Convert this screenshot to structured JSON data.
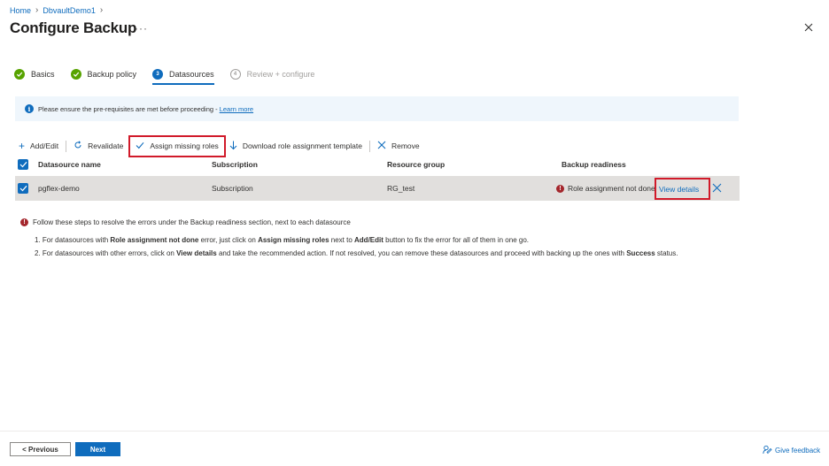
{
  "breadcrumb": {
    "items": [
      "Home",
      "DbvaultDemo1"
    ]
  },
  "page": {
    "title": "Configure Backup",
    "more": "···"
  },
  "steps": [
    {
      "label": "Basics",
      "state": "done"
    },
    {
      "label": "Backup policy",
      "state": "done"
    },
    {
      "label": "Datasources",
      "state": "current",
      "number": "3"
    },
    {
      "label": "Review + configure",
      "state": "future",
      "number": "4"
    }
  ],
  "info": {
    "text": "Please ensure the pre-requisites are met before proceeding - ",
    "link": "Learn more"
  },
  "toolbar": {
    "add_edit": "Add/Edit",
    "revalidate": "Revalidate",
    "assign_roles": "Assign missing roles",
    "download_template": "Download role assignment template",
    "remove": "Remove"
  },
  "table": {
    "headers": [
      "Datasource name",
      "Subscription",
      "Resource group",
      "Backup readiness"
    ],
    "rows": [
      {
        "name": "pgflex-demo",
        "subscription": "Subscription",
        "resource_group": "RG_test",
        "readiness": "Role assignment not done",
        "action": "View details"
      }
    ]
  },
  "instructions": {
    "note": "Follow these steps to resolve the errors under the Backup readiness section, next to each datasource",
    "step1": {
      "p1": "1. For datasources with ",
      "b1": "Role assignment not done",
      "p2": " error, just click on ",
      "b2": "Assign missing roles",
      "p3": " next to ",
      "b3": "Add/Edit",
      "p4": " button to fix the error for all of them in one go."
    },
    "step2": {
      "p1": "2. For datasources with other errors, click on ",
      "b1": "View details",
      "p2": " and take the recommended action. If not resolved, you can remove these datasources and proceed with backing up the ones with ",
      "b2": "Success",
      "p3": " status."
    }
  },
  "footer": {
    "previous": "< Previous",
    "next": "Next",
    "feedback": "Give feedback"
  },
  "colors": {
    "accent": "#0f6cbd",
    "success": "#57a300",
    "error": "#a4262c",
    "highlight": "#d11a2a",
    "info_bg": "#eff6fc",
    "row_bg": "#e1dfdd"
  }
}
